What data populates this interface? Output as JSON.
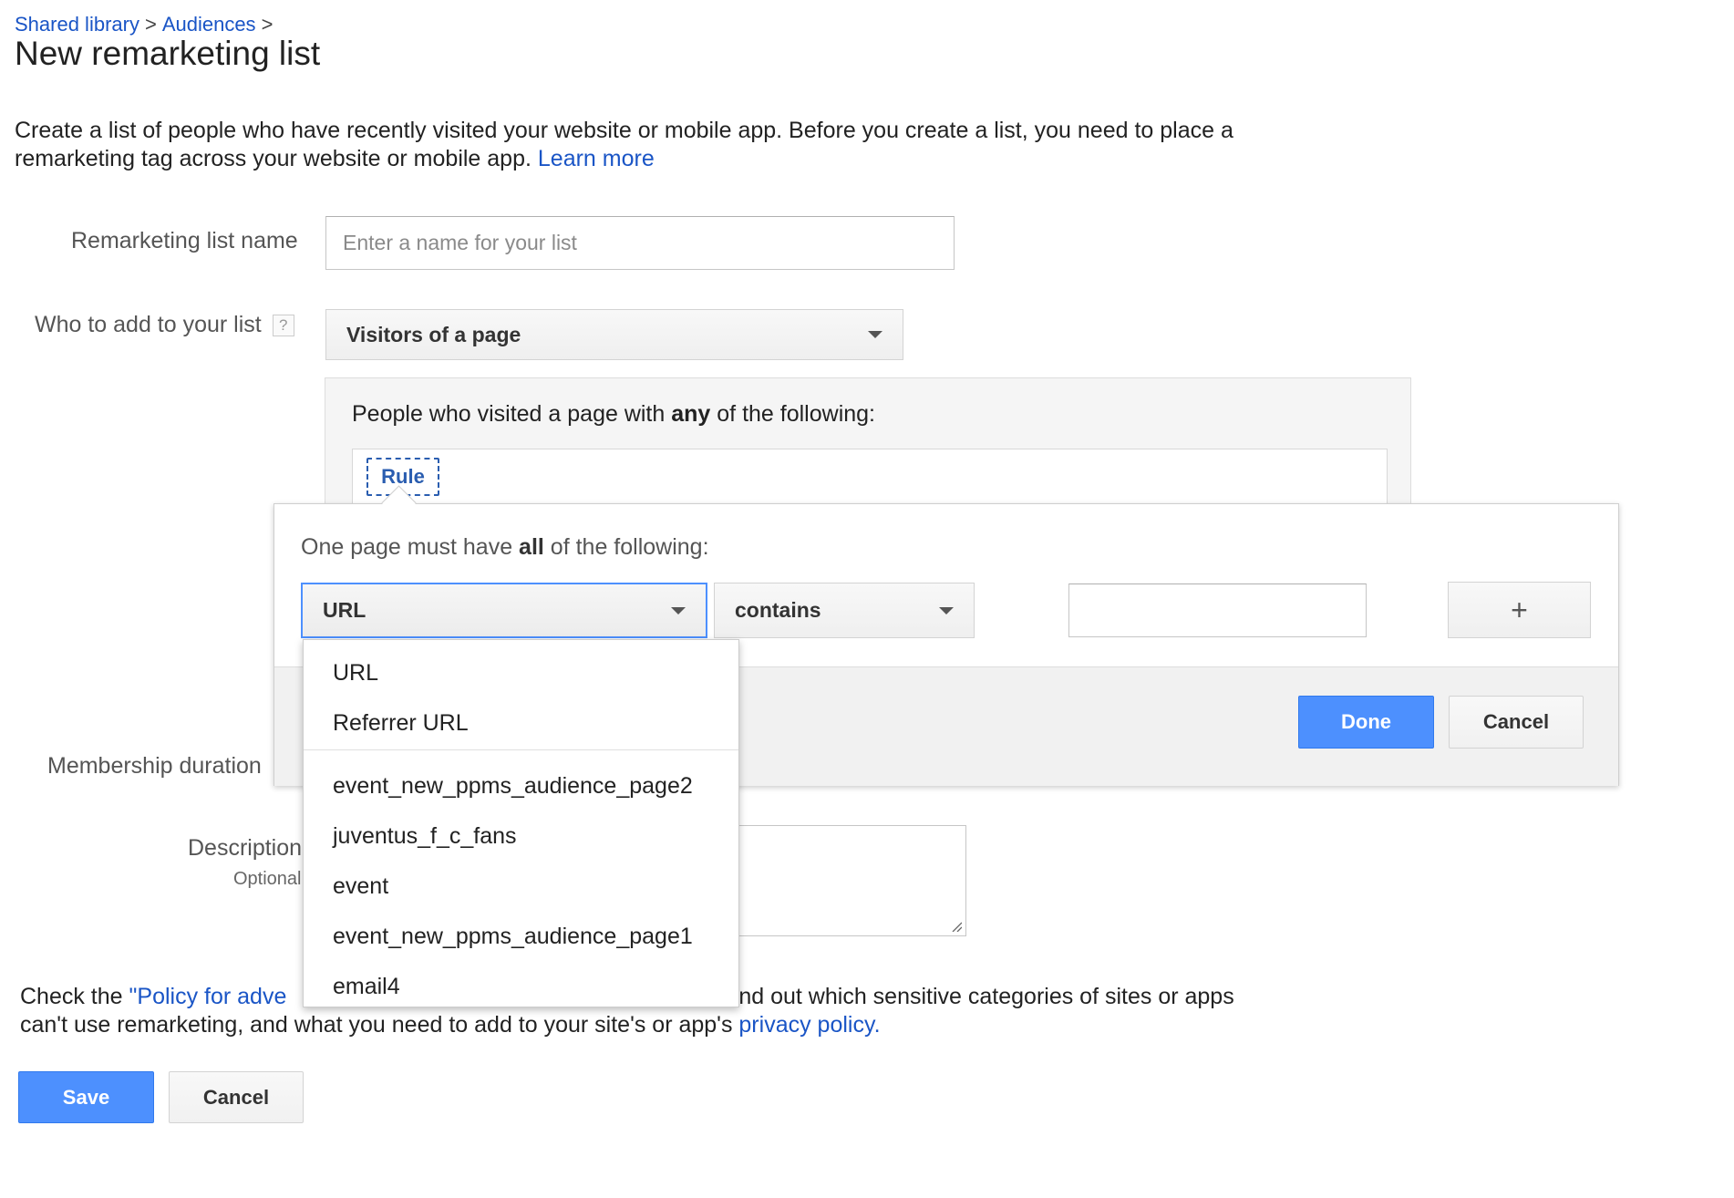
{
  "breadcrumb": {
    "items": [
      "Shared library",
      "Audiences"
    ],
    "separator": ">"
  },
  "page": {
    "title": "New remarketing list",
    "intro_text": "Create a list of people who have recently visited your website or mobile app. Before you create a list, you need to place a remarketing tag across your website or mobile app.",
    "learn_more": "Learn more"
  },
  "form": {
    "name_label": "Remarketing list name",
    "name_placeholder": "Enter a name for your list",
    "name_value": "",
    "who_label": "Who to add to your list",
    "help_glyph": "?",
    "who_value": "Visitors of a page",
    "rule_heading_pre": "People who visited a page with",
    "rule_heading_bold": "any",
    "rule_heading_post": "of the following:",
    "rule_chip": "Rule",
    "membership_label": "Membership duration",
    "description_label": "Description",
    "optional_label": "Optional"
  },
  "popup": {
    "heading_pre": "One page must have",
    "heading_bold": "all",
    "heading_post": "of the following:",
    "field_value": "URL",
    "operator_value": "contains",
    "condition_value": "",
    "add_glyph": "+",
    "done_label": "Done",
    "cancel_label": "Cancel"
  },
  "field_menu": {
    "items": [
      "URL",
      "Referrer URL",
      "event_new_ppms_audience_page2",
      "juventus_f_c_fans",
      "event",
      "event_new_ppms_audience_page1",
      "email4"
    ]
  },
  "policy": {
    "text_pre": "Check the",
    "link_visible": "\"Policy for adve",
    "text_post_partial": "nd out which sensitive categories of sites or apps",
    "line2_pre": "can't use remarketing, and what you need to add to your site's or app's",
    "privacy_link": "privacy policy."
  },
  "actions": {
    "save_label": "Save",
    "cancel_label": "Cancel"
  },
  "colors": {
    "link": "#1a55c6",
    "primary_button": "#4d90fe",
    "focus_border": "#4d90fe"
  },
  "icons": {
    "help": "question-mark-box",
    "caret": "triangle-down",
    "add": "plus",
    "resize": "diagonal-lines"
  }
}
